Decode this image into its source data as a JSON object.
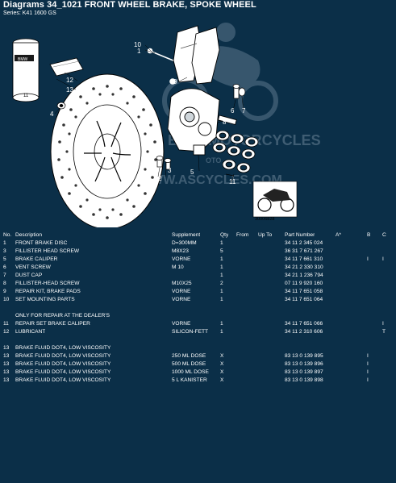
{
  "header": {
    "title": "Diagrams 34_1021 FRONT WHEEL BRAKE, SPOKE WHEEL",
    "series": "Series: K41 1600 GS"
  },
  "diagram": {
    "callouts": [
      "10",
      "1",
      "9",
      "12",
      "13",
      "4",
      "3",
      "2",
      "8",
      "6",
      "7",
      "5",
      "11"
    ],
    "can_label": "11",
    "can_brand": "BMW",
    "image_code": "30006828",
    "watermark_line1": "A&S BMW MOTORCYCLES",
    "watermark_line2": "WWW.ASCYCLES.COM",
    "watermark_mid": "OTO"
  },
  "table": {
    "columns": [
      "No.",
      "Description",
      "Supplement",
      "Qty",
      "From",
      "Up To",
      "Part Number",
      "A*",
      "B",
      "C"
    ],
    "rows_main": [
      {
        "no": "1",
        "desc": "FRONT BRAKE DISC",
        "supp": "D=300MM",
        "qty": "1",
        "from": "",
        "upto": "",
        "part": "34 11 2 345 024",
        "a": "",
        "b": "",
        "c": ""
      },
      {
        "no": "3",
        "desc": "FILLISTER HEAD SCREW",
        "supp": "M8X23",
        "qty": "5",
        "from": "",
        "upto": "",
        "part": "36 31 7 671 267",
        "a": "",
        "b": "",
        "c": ""
      },
      {
        "no": "5",
        "desc": "BRAKE CALIPER",
        "supp": "VORNE",
        "qty": "1",
        "from": "",
        "upto": "",
        "part": "34 11 7 661 310",
        "a": "",
        "b": "I",
        "c": "I"
      },
      {
        "no": "6",
        "desc": "VENT SCREW",
        "supp": "M 10",
        "qty": "1",
        "from": "",
        "upto": "",
        "part": "34 21 2 330 310",
        "a": "",
        "b": "",
        "c": ""
      },
      {
        "no": "7",
        "desc": "DUST CAP",
        "supp": "",
        "qty": "1",
        "from": "",
        "upto": "",
        "part": "34 21 1 236 794",
        "a": "",
        "b": "",
        "c": ""
      },
      {
        "no": "8",
        "desc": "FILLISTER-HEAD SCREW",
        "supp": "M10X25",
        "qty": "2",
        "from": "",
        "upto": "",
        "part": "07 11 9 920 160",
        "a": "",
        "b": "",
        "c": ""
      },
      {
        "no": "9",
        "desc": "REPAIR KIT, BRAKE PADS",
        "supp": "VORNE",
        "qty": "1",
        "from": "",
        "upto": "",
        "part": "34 11 7 651 058",
        "a": "",
        "b": "",
        "c": ""
      },
      {
        "no": "10",
        "desc": "SET MOUNTING PARTS",
        "supp": "VORNE",
        "qty": "1",
        "from": "",
        "upto": "",
        "part": "34 11 7 651 064",
        "a": "",
        "b": "",
        "c": ""
      }
    ],
    "section_dealers": "ONLY FOR REPAIR AT THE DEALER'S",
    "rows_dealer": [
      {
        "no": "11",
        "desc": "REPAIR SET BRAKE CALIPER",
        "supp": "VORNE",
        "qty": "1",
        "from": "",
        "upto": "",
        "part": "34 11 7 651 066",
        "a": "",
        "b": "",
        "c": "I"
      },
      {
        "no": "12",
        "desc": "LUBRICANT",
        "supp": "SILICON-FETT",
        "qty": "1",
        "from": "",
        "upto": "",
        "part": "34 11 2 310 606",
        "a": "",
        "b": "",
        "c": "T"
      }
    ],
    "rows_fluid": [
      {
        "no": "13",
        "desc": "BRAKE FLUID DOT4, LOW VISCOSITY",
        "supp": "",
        "qty": "",
        "from": "",
        "upto": "",
        "part": "",
        "a": "",
        "b": "",
        "c": ""
      },
      {
        "no": "13",
        "desc": "BRAKE FLUID DOT4, LOW VISCOSITY",
        "supp": "250 ML DOSE",
        "qty": "X",
        "from": "",
        "upto": "",
        "part": "83 13 0 139 895",
        "a": "",
        "b": "I",
        "c": ""
      },
      {
        "no": "13",
        "desc": "BRAKE FLUID DOT4, LOW VISCOSITY",
        "supp": "500 ML DOSE",
        "qty": "X",
        "from": "",
        "upto": "",
        "part": "83 13 0 139 896",
        "a": "",
        "b": "I",
        "c": ""
      },
      {
        "no": "13",
        "desc": "BRAKE FLUID DOT4, LOW VISCOSITY",
        "supp": "1000 ML DOSE",
        "qty": "X",
        "from": "",
        "upto": "",
        "part": "83 13 0 139 897",
        "a": "",
        "b": "I",
        "c": ""
      },
      {
        "no": "13",
        "desc": "BRAKE FLUID DOT4, LOW VISCOSITY",
        "supp": "5 L KANISTER",
        "qty": "X",
        "from": "",
        "upto": "",
        "part": "83 13 0 139 898",
        "a": "",
        "b": "I",
        "c": ""
      }
    ]
  }
}
